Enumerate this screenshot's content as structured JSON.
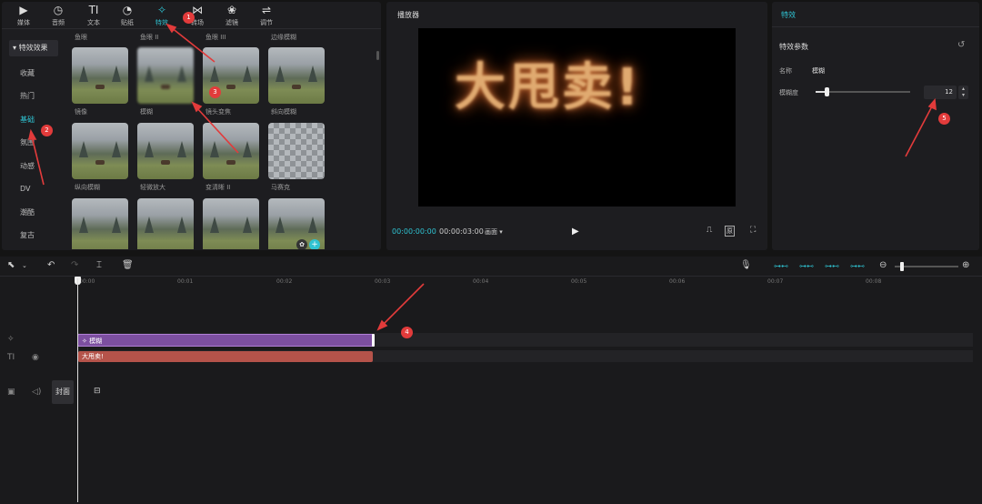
{
  "toolbar": {
    "tools": [
      {
        "label": "媒体",
        "icon": "media-icon",
        "glyph": "▶"
      },
      {
        "label": "音频",
        "icon": "audio-icon",
        "glyph": "◷"
      },
      {
        "label": "文本",
        "icon": "text-icon",
        "glyph": "TI"
      },
      {
        "label": "贴纸",
        "icon": "sticker-icon",
        "glyph": "◔"
      },
      {
        "label": "特效",
        "icon": "effects-icon",
        "glyph": "✧"
      },
      {
        "label": "转场",
        "icon": "transition-icon",
        "glyph": "⋈"
      },
      {
        "label": "滤镜",
        "icon": "filter-icon",
        "glyph": "❀"
      },
      {
        "label": "调节",
        "icon": "adjust-icon",
        "glyph": "⇌"
      }
    ],
    "active": "特效"
  },
  "categories": {
    "header": "特效效果",
    "items": [
      "收藏",
      "热门",
      "基础",
      "氛围",
      "动感",
      "DV",
      "潮酷",
      "复古"
    ],
    "active": "基础"
  },
  "effects_grid": {
    "top_labels": [
      "鱼眼",
      "鱼眼 II",
      "鱼眼 III",
      "边缘模糊"
    ],
    "row1": [
      "镜像",
      "模糊",
      "镜头变焦",
      "斜向模糊"
    ],
    "row2": [
      "纵向模糊",
      "轻微放大",
      "变清晰 II",
      "马赛克"
    ]
  },
  "player": {
    "title": "播放器",
    "preview_text": "大甩卖!",
    "current_time": "00:00:00:00",
    "total_time": "00:00:03:00",
    "ratio": "画面"
  },
  "effect_panel": {
    "tab": "特效",
    "section": "特效参数",
    "name_label": "名称",
    "name_value": "模糊",
    "param_label": "模糊度",
    "param_value": "12",
    "param_fraction": 0.12
  },
  "timeline": {
    "ticks": [
      "00:00",
      "00:01",
      "00:02",
      "00:03",
      "00:04",
      "00:05",
      "00:06",
      "00:07",
      "00:08"
    ],
    "fx_clip": "模糊",
    "text_clip": "大甩卖!",
    "cover_label": "封面"
  },
  "annotations": [
    "1",
    "2",
    "3",
    "4",
    "5"
  ],
  "colors": {
    "accent": "#2fc3d2",
    "fx_clip": "#7c4fa0",
    "text_clip": "#b5534a",
    "marker": "#e23b3b"
  }
}
